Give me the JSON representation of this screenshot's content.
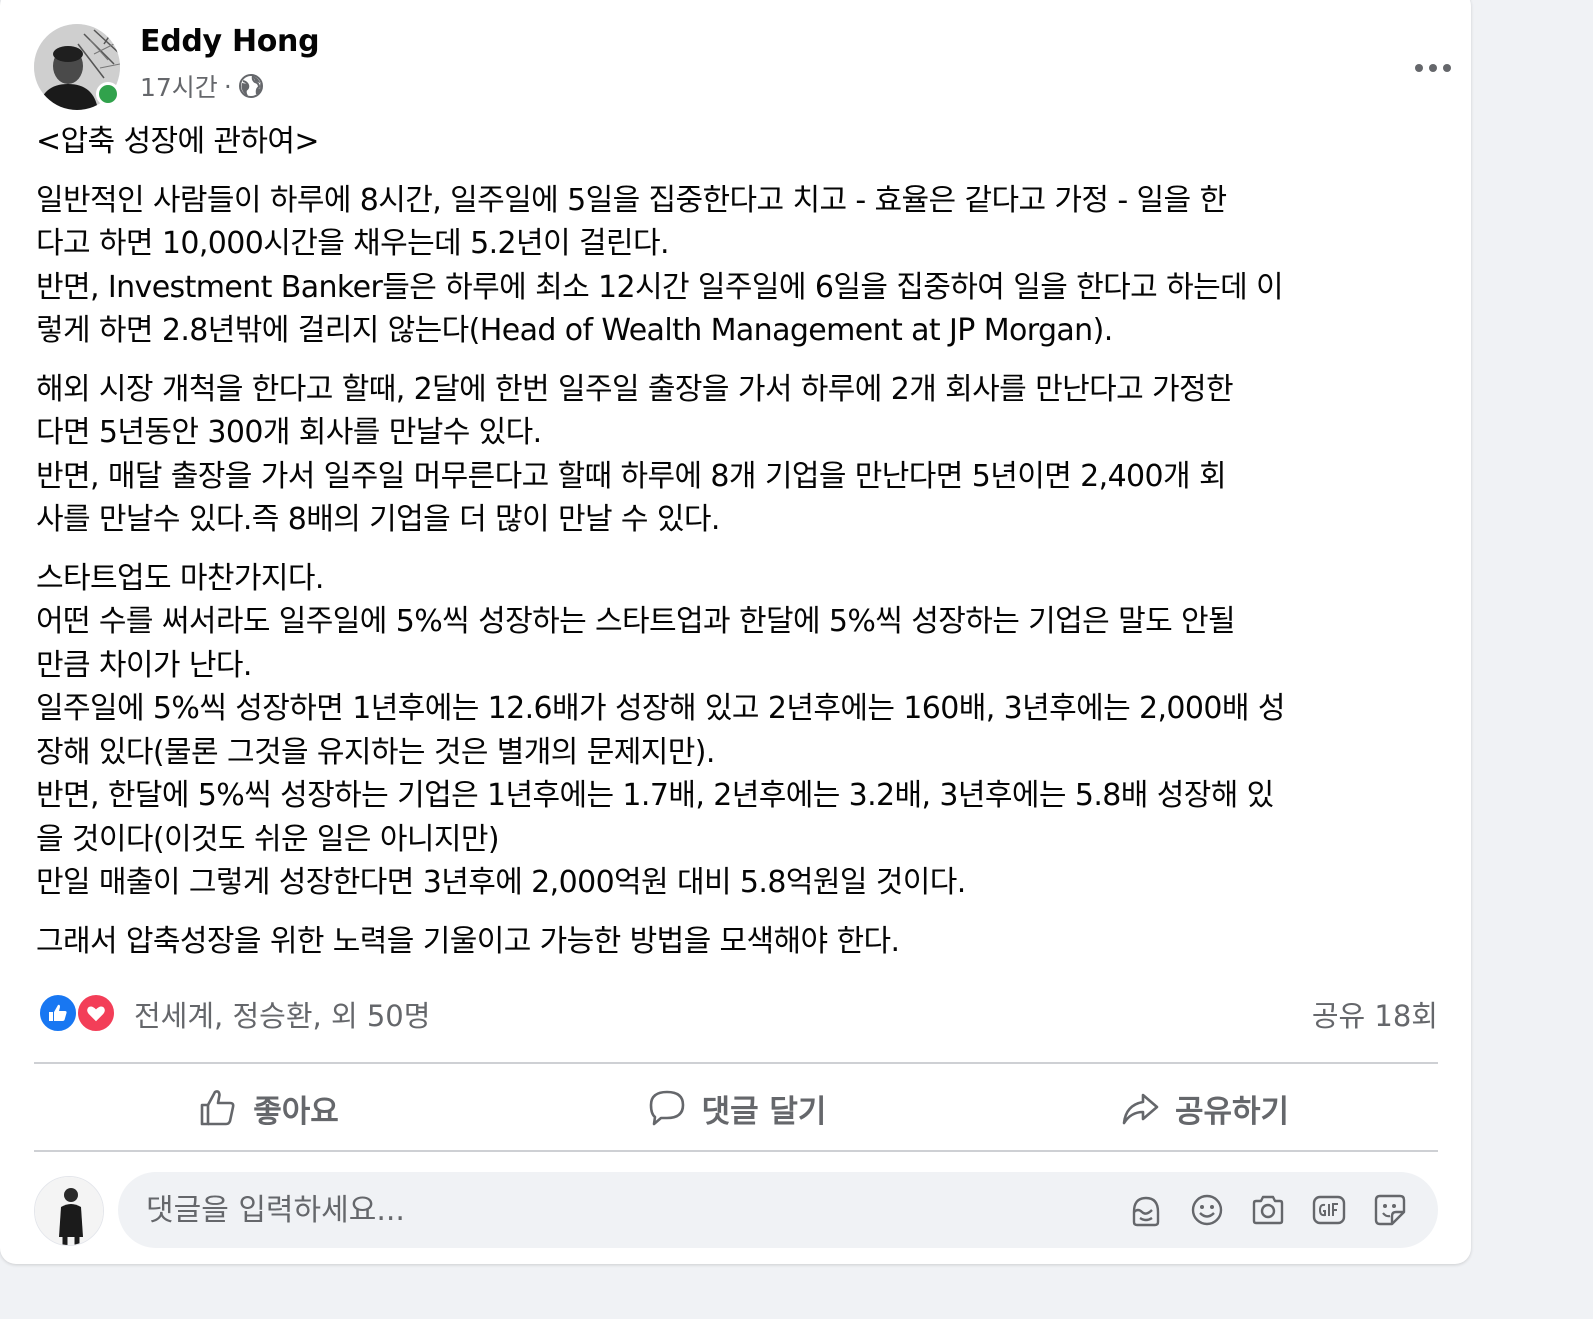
{
  "post": {
    "author": "Eddy Hong",
    "time": "17시간",
    "separator": "·",
    "privacy_icon": "globe-icon",
    "paragraphs": [
      "<압축 성장에 관하여>",
      "일반적인 사람들이 하루에 8시간, 일주일에 5일을 집중한다고 치고 - 효율은 같다고 가정 - 일을 한\n다고 하면 10,000시간을 채우는데 5.2년이 걸린다.\n반면, Investment Banker들은 하루에 최소 12시간 일주일에 6일을 집중하여 일을 한다고 하는데 이\n렇게 하면 2.8년밖에 걸리지 않는다(Head of Wealth Management at JP Morgan).",
      "해외 시장 개척을 한다고 할때, 2달에 한번 일주일 출장을 가서 하루에 2개 회사를 만난다고 가정한\n다면 5년동안 300개 회사를 만날수 있다.\n반면, 매달 출장을 가서 일주일 머무른다고 할때 하루에 8개 기업을 만난다면 5년이면 2,400개 회\n사를 만날수 있다.즉 8배의 기업을 더 많이 만날 수 있다.",
      "스타트업도 마찬가지다.\n어떤 수를 써서라도 일주일에 5%씩 성장하는 스타트업과 한달에 5%씩 성장하는 기업은 말도 안될\n만큼 차이가 난다.\n일주일에 5%씩 성장하면 1년후에는 12.6배가 성장해 있고 2년후에는 160배, 3년후에는 2,000배 성\n장해 있다(물론 그것을 유지하는 것은 별개의 문제지만).\n반면, 한달에 5%씩 성장하는 기업은 1년후에는 1.7배, 2년후에는 3.2배, 3년후에는 5.8배 성장해 있\n을 것이다(이것도 쉬운 일은 아니지만)\n만일 매출이 그렇게 성장한다면 3년후에 2,000억원 대비 5.8억원일 것이다.",
      "그래서 압축성장을 위한 노력을 기울이고 가능한 방법을 모색해야 한다."
    ],
    "reactions": {
      "icons": [
        "like-icon",
        "love-icon"
      ],
      "summary": "전세계, 정승환, 외 50명",
      "shares": "공유 18회"
    },
    "actions": {
      "like": "좋아요",
      "comment": "댓글 달기",
      "share": "공유하기"
    },
    "comment_box": {
      "placeholder": "댓글을 입력하세요...",
      "tools": [
        "avatar-sticker-icon",
        "emoji-icon",
        "camera-icon",
        "gif-icon",
        "sticker-icon"
      ]
    }
  },
  "colors": {
    "background": "#f0f2f5",
    "card": "#ffffff",
    "text_primary": "#050505",
    "text_secondary": "#65676b",
    "like_blue": "#1877f2",
    "love_red": "#f33e58",
    "online_green": "#31a24c"
  }
}
